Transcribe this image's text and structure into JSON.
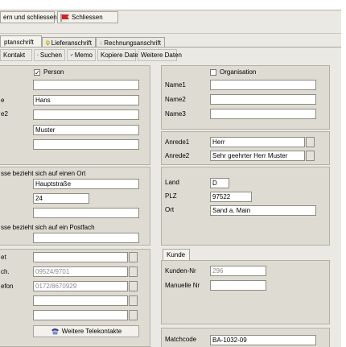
{
  "toolbar": {
    "save_close_label": "ern und schliessen",
    "close_label": "Schliessen"
  },
  "tabs": [
    {
      "label": "ptanschrift"
    },
    {
      "label": "Lieferanschrift"
    },
    {
      "label": "Rechnungsanschrift"
    }
  ],
  "subtoolbar": {
    "kontakt": "Kontakt",
    "suchen": "Suchen",
    "memo": "Memo",
    "kopiere": "Kopiere Daten",
    "weitere": "Weitere Daten"
  },
  "person": {
    "checkbox_label": "Person",
    "label_firstname": "e",
    "label_second": "e2",
    "firstname": "Hans",
    "lastname": "Muster"
  },
  "organisation": {
    "checkbox_label": "Organisation",
    "name1_label": "Name1",
    "name2_label": "Name2",
    "name3_label": "Name3"
  },
  "anrede": {
    "label1": "Anrede1",
    "label2": "Anrede2",
    "value1": "Herr",
    "value2": "Sehr geehrter Herr Muster"
  },
  "address": {
    "ort_header": "sse bezieht sich auf einen Ort",
    "street": "Hauptstraße",
    "number": "24",
    "postfach_header": "sse bezieht sich auf ein Postfach",
    "land_label": "Land",
    "plz_label": "PLZ",
    "ort_label": "Ort",
    "land": "D",
    "plz": "97522",
    "ort": "Sand a. Main"
  },
  "contacts": {
    "label1": "et",
    "label2": "ch.",
    "label3": "efon",
    "phone1": "09524/9701",
    "phone2": "0172/8670929",
    "more_button": "Weitere Telekontakte"
  },
  "kunde": {
    "tab": "Kunde",
    "nr_label": "Kunden-Nr",
    "nr": "296",
    "manual_label": "Manuelle Nr"
  },
  "matchcode": {
    "label": "Matchcode",
    "value": "BA-1032-09"
  },
  "colors": {
    "background": "#ebe9e3",
    "panel": "#dedbd3",
    "field": "#ffffff"
  }
}
